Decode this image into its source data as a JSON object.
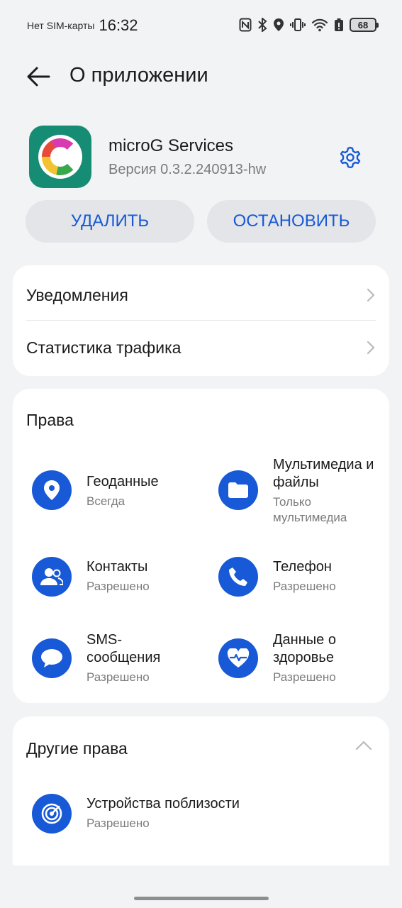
{
  "status_bar": {
    "sim": "Нет SIM-карты",
    "time": "16:32",
    "battery": "68"
  },
  "header": {
    "title": "О приложении"
  },
  "app": {
    "name": "microG Services",
    "version": "Версия 0.3.2.240913-hw"
  },
  "actions": {
    "uninstall": "УДАЛИТЬ",
    "stop": "ОСТАНОВИТЬ"
  },
  "links": {
    "notifications": "Уведомления",
    "traffic": "Статистика трафика"
  },
  "permissions": {
    "title": "Права",
    "items": [
      {
        "name": "Геоданные",
        "status": "Всегда",
        "icon": "location-icon"
      },
      {
        "name": "Мультимедиа и файлы",
        "status": "Только мультимедиа",
        "icon": "folder-icon"
      },
      {
        "name": "Контакты",
        "status": "Разрешено",
        "icon": "contacts-icon"
      },
      {
        "name": "Телефон",
        "status": "Разрешено",
        "icon": "phone-icon"
      },
      {
        "name": "SMS-сообщения",
        "status": "Разрешено",
        "icon": "sms-icon"
      },
      {
        "name": "Данные о здоровье",
        "status": "Разрешено",
        "icon": "health-icon"
      }
    ]
  },
  "other_permissions": {
    "title": "Другие права",
    "items": [
      {
        "name": "Устройства поблизости",
        "status": "Разрешено",
        "icon": "nearby-devices-icon"
      }
    ]
  },
  "colors": {
    "accent": "#1759d6",
    "app_icon_bg": "#178c74",
    "background": "#f1f3f5"
  }
}
